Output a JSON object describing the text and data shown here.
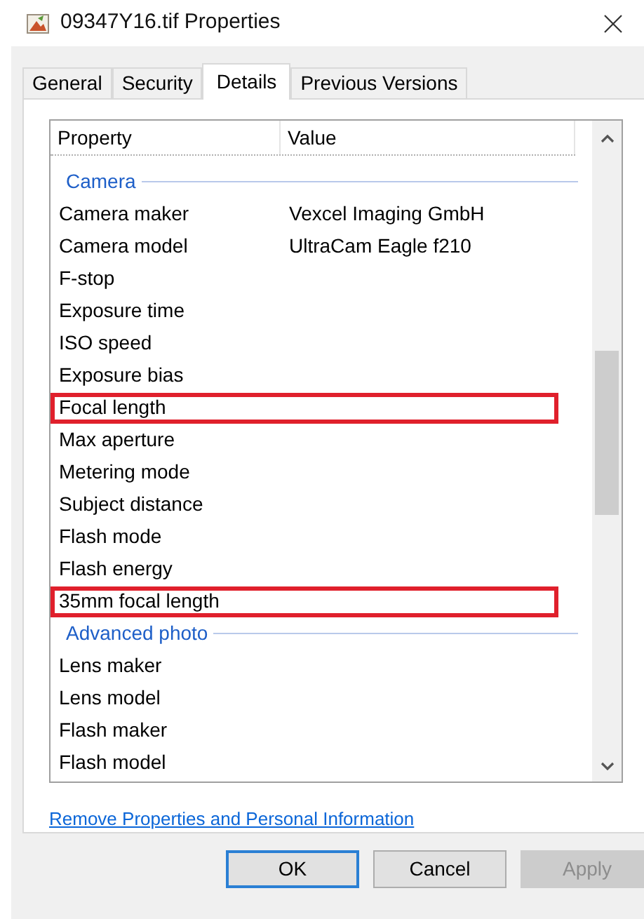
{
  "window": {
    "title": "09347Y16.tif Properties"
  },
  "tabs": [
    {
      "label": "General",
      "selected": false
    },
    {
      "label": "Security",
      "selected": false
    },
    {
      "label": "Details",
      "selected": true
    },
    {
      "label": "Previous Versions",
      "selected": false
    }
  ],
  "table": {
    "columns": [
      "Property",
      "Value"
    ],
    "rows": [
      {
        "kind": "group",
        "label": "Camera"
      },
      {
        "kind": "item",
        "property": "Camera maker",
        "value": "Vexcel Imaging GmbH",
        "highlighted": false
      },
      {
        "kind": "item",
        "property": "Camera model",
        "value": "UltraCam Eagle f210",
        "highlighted": false
      },
      {
        "kind": "item",
        "property": "F-stop",
        "highlighted": false
      },
      {
        "kind": "item",
        "property": "Exposure time",
        "highlighted": false
      },
      {
        "kind": "item",
        "property": "ISO speed",
        "highlighted": false
      },
      {
        "kind": "item",
        "property": "Exposure bias",
        "highlighted": false
      },
      {
        "kind": "item",
        "property": "Focal length",
        "highlighted": true
      },
      {
        "kind": "item",
        "property": "Max aperture",
        "highlighted": false
      },
      {
        "kind": "item",
        "property": "Metering mode",
        "highlighted": false
      },
      {
        "kind": "item",
        "property": "Subject distance",
        "highlighted": false
      },
      {
        "kind": "item",
        "property": "Flash mode",
        "highlighted": false
      },
      {
        "kind": "item",
        "property": "Flash energy",
        "highlighted": false
      },
      {
        "kind": "item",
        "property": "35mm focal length",
        "highlighted": true
      },
      {
        "kind": "group",
        "label": "Advanced photo"
      },
      {
        "kind": "item",
        "property": "Lens maker",
        "highlighted": false
      },
      {
        "kind": "item",
        "property": "Lens model",
        "highlighted": false
      },
      {
        "kind": "item",
        "property": "Flash maker",
        "highlighted": false
      },
      {
        "kind": "item",
        "property": "Flash model",
        "highlighted": false
      }
    ]
  },
  "link": "Remove Properties and Personal Information",
  "buttons": [
    {
      "label": "OK",
      "disabled": false,
      "default": true
    },
    {
      "label": "Cancel",
      "disabled": false,
      "default": false
    },
    {
      "label": "Apply",
      "disabled": true,
      "default": false
    }
  ]
}
